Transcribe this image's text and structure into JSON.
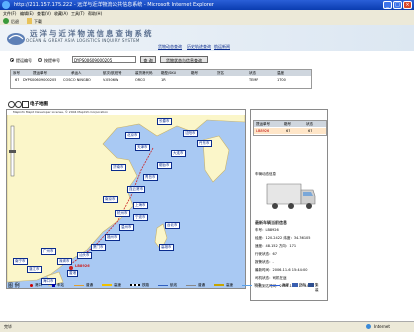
{
  "window": {
    "title": "http://211.157.175.222 - 远洋与近洋物流公共信息系统 - Microsoft Internet Explorer"
  },
  "menu": [
    "文件(F)",
    "编辑(E)",
    "查看(V)",
    "收藏(A)",
    "工具(T)",
    "帮助(H)"
  ],
  "toolbar": {
    "back": "后退",
    "forward": "下载"
  },
  "banner": {
    "title_cn": "远洋与近洋物流信息查询系统",
    "title_en": "OCEAN & GREAT ASIA LOGISTICS INQUIRY SYSTEM",
    "nav": [
      "货物动态查询",
      "历史轨迹查询",
      "航运新闻"
    ]
  },
  "query": {
    "radio1": "提运编号",
    "radio2": "按提单号",
    "input_value": "DYPS00609000205",
    "search_btn": "查 询",
    "detail_btn": "货物状态与信息查询"
  },
  "table": {
    "headers": [
      "序号",
      "提运单号",
      "承运人",
      "航次/航班号",
      "装货港代码",
      "箱型/SKU",
      "箱号",
      "货名",
      "状态",
      "温度"
    ],
    "row": [
      "67",
      "DYPS00609000205",
      "COSCO NINGBO",
      "V.0506W",
      "ORCO",
      "1R",
      "",
      "",
      "TEMP",
      "1T00"
    ]
  },
  "map": {
    "toolbar_label": "电子地图",
    "header_note": "Mapinfo MapX Developer License, © 2004 MapInfo Corporation",
    "places": [
      "沈阳市",
      "天津市",
      "大连市",
      "烟台市",
      "济南市",
      "青岛市",
      "连云港市",
      "南京市",
      "上海市",
      "杭州市",
      "宁波市",
      "温州市",
      "福州市",
      "厦门市",
      "汕头市",
      "广州市",
      "深圳市",
      "香港",
      "台北市",
      "高雄市",
      "海口市",
      "南宁市",
      "湛江市",
      "丹东市",
      "长春市",
      "北京市"
    ],
    "highlight": "LB8926"
  },
  "panel": {
    "table_headers": [
      "提运单号",
      "箱号",
      "状态"
    ],
    "table_row": [
      "LB8926",
      "67",
      "67"
    ],
    "image_caption": "车辆动态信息",
    "info_title": "最新车辆当前信息",
    "lines": [
      "车号：LB8926",
      "经度：120.2422 纬度：34.36105",
      "速度：48.152 方向：171",
      "行驶状态：67",
      "报警状态：-",
      "最新时间：2006-11-6 15:44:00",
      "司机状态：司机在途",
      "计划到达时间：2006-11-6 17:44:47"
    ]
  },
  "legend": {
    "title": "图 例",
    "items": [
      "港口",
      "车站",
      "普通",
      "高速",
      "铁路",
      "航线",
      "普通",
      "高速",
      "河流",
      "海岸",
      "货车",
      "集装"
    ]
  },
  "status": {
    "done": "完毕",
    "zone": "Internet"
  },
  "colors": {
    "sea": "#a9c9f3",
    "land": "#fbf6c9",
    "route": "#cc2222",
    "titlebar": "#0a3cb0"
  }
}
